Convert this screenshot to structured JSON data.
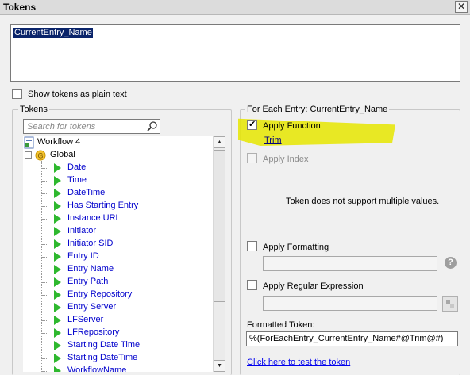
{
  "window": {
    "title": "Tokens",
    "close_glyph": "✕"
  },
  "editor": {
    "content": "CurrentEntry_Name"
  },
  "show_plain": {
    "label": "Show tokens as plain text",
    "checked": false
  },
  "tokens_panel": {
    "legend": "Tokens",
    "search_placeholder": "Search for tokens",
    "root": "Workflow 4",
    "group": "Global",
    "items": [
      "Date",
      "Time",
      "DateTime",
      "Has Starting Entry",
      "Instance URL",
      "Initiator",
      "Initiator SID",
      "Entry ID",
      "Entry Name",
      "Entry Path",
      "Entry Repository",
      "Entry Server",
      "LFServer",
      "LFRepository",
      "Starting Date Time",
      "Starting DateTime",
      "WorkflowName"
    ]
  },
  "entry_panel": {
    "legend": "For Each Entry: CurrentEntry_Name",
    "apply_function": {
      "label": "Apply Function",
      "checked": true,
      "function_link": "Trim"
    },
    "apply_index": {
      "label": "Apply Index",
      "enabled": false
    },
    "index_message": "Token does not support multiple values.",
    "apply_formatting": {
      "label": "Apply Formatting",
      "checked": false,
      "value": ""
    },
    "apply_regex": {
      "label": "Apply Regular Expression",
      "checked": false,
      "value": ""
    },
    "formatted_label": "Formatted Token:",
    "formatted_value": "%(ForEachEntry_CurrentEntry_Name#@Trim@#)",
    "test_link": "Click here to test the token"
  },
  "colors": {
    "highlight": "#e6e600",
    "token_text": "#0000cc",
    "token_icon": "#2eb82e"
  }
}
